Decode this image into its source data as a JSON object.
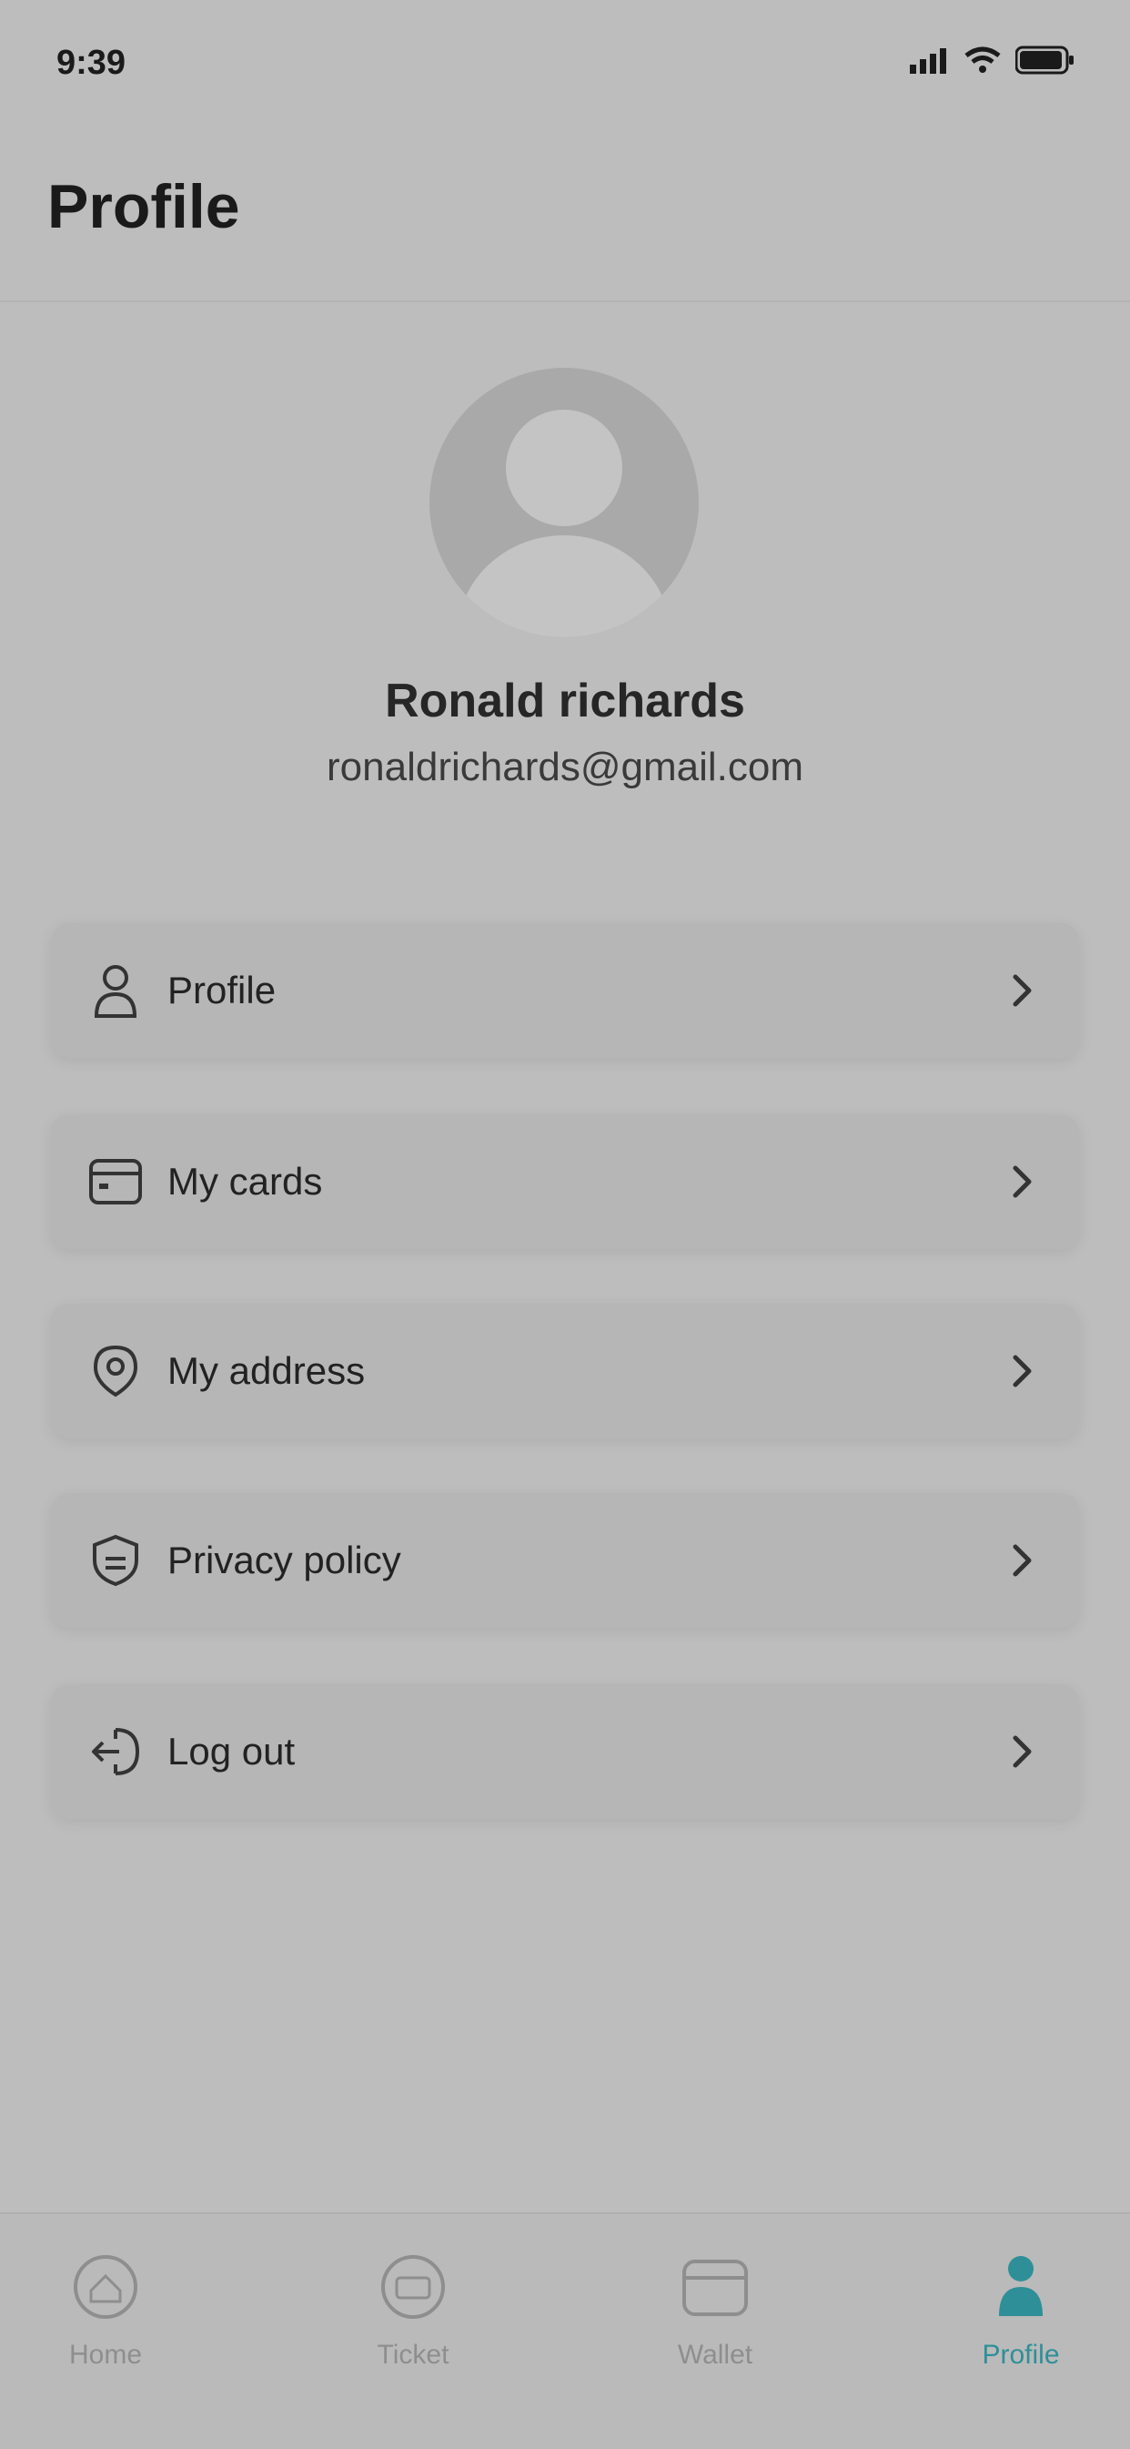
{
  "status_bar": {
    "time": "9:39"
  },
  "header": {
    "title": "Profile"
  },
  "profile": {
    "name": "Ronald richards",
    "email": "ronaldrichards@gmail.com",
    "avatar_icon": "user-silhouette-icon"
  },
  "menu": {
    "items": [
      {
        "label": "Profile",
        "icon": "user-icon"
      },
      {
        "label": "My cards",
        "icon": "card-icon"
      },
      {
        "label": "My address",
        "icon": "location-icon"
      },
      {
        "label": "Privacy policy",
        "icon": "shield-icon"
      },
      {
        "label": "Log out",
        "icon": "logout-icon"
      }
    ]
  },
  "tab_bar": {
    "items": [
      {
        "label": "Home",
        "icon": "home-icon",
        "active": false
      },
      {
        "label": "Ticket",
        "icon": "ticket-icon",
        "active": false
      },
      {
        "label": "Wallet",
        "icon": "wallet-icon",
        "active": false
      },
      {
        "label": "Profile",
        "icon": "profile-icon",
        "active": true
      }
    ],
    "active_color": "#2f8f98",
    "inactive_color": "#8e8e8e"
  }
}
